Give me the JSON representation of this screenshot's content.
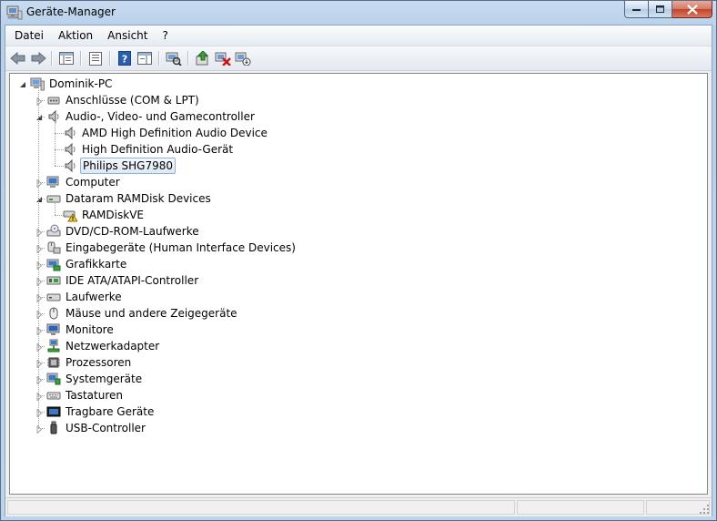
{
  "window": {
    "title": "Geräte-Manager"
  },
  "menu": {
    "items": [
      "Datei",
      "Aktion",
      "Ansicht",
      "?"
    ]
  },
  "toolbar": {
    "buttons": [
      {
        "icon": "back-arrow-icon"
      },
      {
        "icon": "forward-arrow-icon"
      },
      {
        "icon": "show-hide-console-tree-icon"
      },
      {
        "icon": "properties-icon"
      },
      {
        "icon": "help-icon"
      },
      {
        "icon": "action-pane-icon"
      },
      {
        "icon": "scan-hardware-icon"
      },
      {
        "icon": "update-driver-icon"
      },
      {
        "icon": "uninstall-device-icon"
      },
      {
        "icon": "disable-device-icon"
      }
    ]
  },
  "tree": {
    "root": "Dominik-PC",
    "items": [
      {
        "label": "Anschlüsse (COM & LPT)",
        "icon": "port-icon",
        "expanded": false
      },
      {
        "label": "Audio-, Video- und Gamecontroller",
        "icon": "speaker-icon",
        "expanded": true,
        "children": [
          {
            "label": "AMD High Definition Audio Device",
            "icon": "speaker-icon"
          },
          {
            "label": "High Definition Audio-Gerät",
            "icon": "speaker-icon"
          },
          {
            "label": "Philips SHG7980",
            "icon": "speaker-icon",
            "selected": true
          }
        ]
      },
      {
        "label": "Computer",
        "icon": "computer-icon",
        "expanded": false
      },
      {
        "label": "Dataram RAMDisk Devices",
        "icon": "disk-icon",
        "expanded": true,
        "children": [
          {
            "label": "RAMDiskVE",
            "icon": "disk-warning-icon"
          }
        ]
      },
      {
        "label": "DVD/CD-ROM-Laufwerke",
        "icon": "dvd-icon",
        "expanded": false
      },
      {
        "label": "Eingabegeräte (Human Interface Devices)",
        "icon": "hid-icon",
        "expanded": false
      },
      {
        "label": "Grafikkarte",
        "icon": "display-adapter-icon",
        "expanded": false
      },
      {
        "label": "IDE ATA/ATAPI-Controller",
        "icon": "ide-controller-icon",
        "expanded": false
      },
      {
        "label": "Laufwerke",
        "icon": "drive-icon",
        "expanded": false
      },
      {
        "label": "Mäuse und andere Zeigegeräte",
        "icon": "mouse-icon",
        "expanded": false
      },
      {
        "label": "Monitore",
        "icon": "monitor-icon",
        "expanded": false
      },
      {
        "label": "Netzwerkadapter",
        "icon": "network-icon",
        "expanded": false
      },
      {
        "label": "Prozessoren",
        "icon": "processor-icon",
        "expanded": false
      },
      {
        "label": "Systemgeräte",
        "icon": "system-device-icon",
        "expanded": false
      },
      {
        "label": "Tastaturen",
        "icon": "keyboard-icon",
        "expanded": false
      },
      {
        "label": "Tragbare Geräte",
        "icon": "portable-device-icon",
        "expanded": false
      },
      {
        "label": "USB-Controller",
        "icon": "usb-icon",
        "expanded": false
      }
    ]
  },
  "colors": {
    "selection_border": "#8fb2d6",
    "close_button": "#c2432a",
    "frame": "#bcd3ec"
  }
}
